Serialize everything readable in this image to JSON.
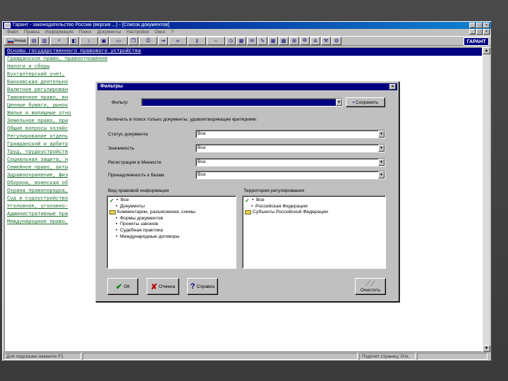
{
  "window": {
    "title": "Гарант - законодательство России (версия ...) - [Список документов]",
    "menu": [
      "Файл",
      "Правка",
      "Информация",
      "Поиск",
      "Документы",
      "Настройки",
      "Окно",
      "?"
    ],
    "toolbar_first": "Назад",
    "logo": "ГАРАНТ"
  },
  "document_list": [
    "Основы государственного правового устройства",
    "Гражданское право, правоотношения",
    "Налоги и сборы",
    "Бухгалтерский учет,",
    "Банковская деятельно",
    "Валютное регулирован",
    "Таможенное право, вн",
    "Ценные бумаги, рынок",
    "Жилье и жилищные отно",
    "Земельное право, при",
    "Общие вопросы хозяйс",
    "Регулирование отдель",
    "Гражданский и арбитр",
    "Труд, трудоустройств",
    "Социальная защита, н",
    "Семейное право, акты",
    "Здравоохранение, физ",
    "Оборона, воинская об",
    "Охрана правопорядка,",
    "Суд и судоустройство",
    "Уголовное, уголовно-",
    "Административные пра",
    "Международное право,"
  ],
  "status": {
    "hint": "Для подсказки нажмите F1",
    "page_info": "Подсчет страниц: Отк."
  },
  "dialog": {
    "title": "Фильтры",
    "filter_label": "Фильтр",
    "filter_value": "",
    "save_button": "Сохранить",
    "criteria_heading": "Включать в поиск только документы, удовлетворяющие критериям:",
    "fields": [
      {
        "label": "Статус документа",
        "value": "Все"
      },
      {
        "label": "Значимость",
        "value": "Все"
      },
      {
        "label": "Регистрация в Минюсте",
        "value": "Все"
      },
      {
        "label": "Принадлежность к базам",
        "value": "Все"
      }
    ],
    "legal_info_heading": "Вид правовой информации",
    "legal_info_tree": [
      {
        "label": "Все",
        "level": 0,
        "icon": "check"
      },
      {
        "label": "Документы",
        "level": 1,
        "icon": "bullet"
      },
      {
        "label": "Комментарии, разъяснения, схемы",
        "level": 0,
        "icon": "folder"
      },
      {
        "label": "Формы документов",
        "level": 1,
        "icon": "bullet"
      },
      {
        "label": "Проекты законов",
        "level": 1,
        "icon": "bullet"
      },
      {
        "label": "Судебная практика",
        "level": 1,
        "icon": "bullet"
      },
      {
        "label": "Международные договоры",
        "level": 1,
        "icon": "bullet"
      }
    ],
    "territory_heading": "Территория регулирования",
    "territory_tree": [
      {
        "label": "Все",
        "level": 0,
        "icon": "check"
      },
      {
        "label": "Российская Федерация",
        "level": 1,
        "icon": "bullet"
      },
      {
        "label": "Субъекты Российской Федерации",
        "level": 0,
        "icon": "folder"
      }
    ],
    "ok_button": "ОК",
    "cancel_button": "Отмена",
    "help_button": "Справка",
    "clear_button": "Очистить"
  }
}
